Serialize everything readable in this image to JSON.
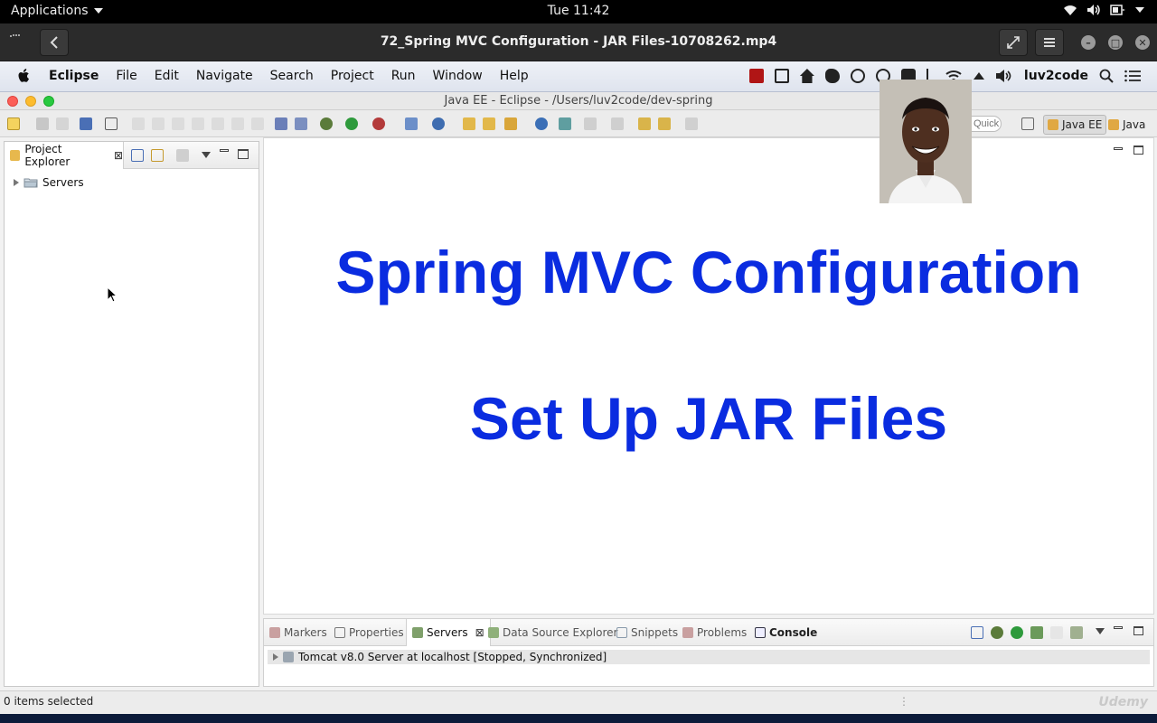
{
  "gnome": {
    "applications_label": "Applications",
    "clock": "Tue 11:42",
    "icons": [
      "wifi-icon",
      "volume-icon",
      "battery-icon",
      "system-menu-icon"
    ]
  },
  "player": {
    "title": "72_Spring MVC Configuration - JAR Files-10708262.mp4",
    "icons": [
      "back-icon",
      "fullscreen-icon",
      "hamburger-icon",
      "minimize-icon",
      "maximize-icon",
      "close-icon"
    ]
  },
  "mac_menu": {
    "app_name": "Eclipse",
    "items": [
      "File",
      "Edit",
      "Navigate",
      "Search",
      "Project",
      "Run",
      "Window",
      "Help"
    ],
    "user": "luv2code"
  },
  "eclipse": {
    "window_title": "Java EE - Eclipse - /Users/luv2code/dev-spring",
    "quick_access_placeholder": "Quick Access",
    "perspectives": [
      "Java EE",
      "Java"
    ]
  },
  "project_explorer": {
    "tab_label": "Project Explorer",
    "tree": [
      {
        "label": "Servers"
      }
    ]
  },
  "slide": {
    "title_line1": "Spring MVC Configuration",
    "title_line2": "Set Up JAR Files",
    "text_color": "#0a2ce0"
  },
  "bottom_panel": {
    "tabs": [
      "Markers",
      "Properties",
      "Servers",
      "Data Source Explorer",
      "Snippets",
      "Problems",
      "Console"
    ],
    "active_tab": "Servers",
    "server_row": "Tomcat v8.0 Server at localhost  [Stopped, Synchronized]"
  },
  "status_bar": {
    "text": "0 items selected",
    "watermark": "Udemy"
  }
}
